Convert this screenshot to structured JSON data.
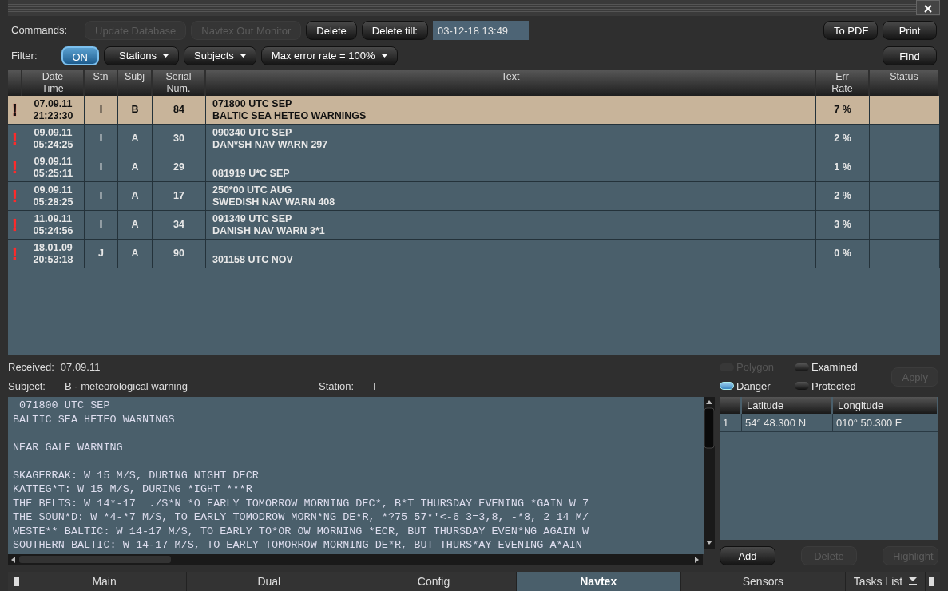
{
  "commands": {
    "label": "Commands:",
    "buttons": [
      {
        "label": "Update Database",
        "disabled": true
      },
      {
        "label": "Navtex Out Monitor",
        "disabled": true
      },
      {
        "label": "Delete",
        "disabled": false
      },
      {
        "label": "Delete till:",
        "disabled": false
      }
    ],
    "delete_till_value": "03-12-18 13:49",
    "right_buttons": [
      "To PDF",
      "Print"
    ]
  },
  "filter": {
    "label": "Filter:",
    "toggle": {
      "label": "ON",
      "on": true
    },
    "dropdowns": [
      "Stations",
      "Subjects",
      "Max error rate = 100%"
    ],
    "find_button": "Find"
  },
  "table": {
    "columns": [
      "Date Time",
      "Stn",
      "Subj",
      "Serial Num.",
      "Text",
      "Err Rate",
      "Status"
    ],
    "rows": [
      {
        "flag": "!",
        "date": "07.09.11",
        "time": "21:23:30",
        "stn": "I",
        "subj": "B",
        "serial": "84",
        "text": [
          "071800 UTC SEP",
          "BALTIC SEA HETEO WARNINGS"
        ],
        "err": "7 %",
        "selected": true
      },
      {
        "flag": "!",
        "date": "09.09.11",
        "time": "05:24:25",
        "stn": "I",
        "subj": "A",
        "serial": "30",
        "text": [
          "090340 UTC SEP",
          "DAN*SH NAV WARN 297"
        ],
        "err": "2 %",
        "selected": false
      },
      {
        "flag": "!",
        "date": "09.09.11",
        "time": "05:25:11",
        "stn": "I",
        "subj": "A",
        "serial": "29",
        "text": [
          "081919 U*C SEP"
        ],
        "err": "1 %",
        "selected": false
      },
      {
        "flag": "!",
        "date": "09.09.11",
        "time": "05:28:25",
        "stn": "I",
        "subj": "A",
        "serial": "17",
        "text": [
          "250*00 UTC AUG",
          "SWEDISH NAV WARN 408"
        ],
        "err": "2 %",
        "selected": false
      },
      {
        "flag": "!",
        "date": "11.09.11",
        "time": "05:24:56",
        "stn": "I",
        "subj": "A",
        "serial": "34",
        "text": [
          "091349 UTC SEP",
          "DANISH NAV WARN 3*1"
        ],
        "err": "3 %",
        "selected": false
      },
      {
        "flag": "!",
        "date": "18.01.09",
        "time": "20:53:18",
        "stn": "J",
        "subj": "A",
        "serial": "90",
        "text": [
          "301158 UTC NOV"
        ],
        "err": "0 %",
        "selected": false
      }
    ]
  },
  "details": {
    "received_label": "Received:",
    "received": "07.09.11",
    "subject_label": "Subject:",
    "subject": "B - meteorological warning",
    "station_label": "Station:",
    "station": "I",
    "message_paragraphs": [
      [
        " 071800 UTC SEP",
        "BALTIC SEA HETEO WARNINGS"
      ],
      [
        "NEAR GALE WARNING"
      ],
      [
        "SKAGERRAK: W 15 M/S, DURING NIGHT DECR",
        "KATTEG*T: W 15 M/S, DURING *IGHT ***R",
        "THE BELTS: W 14*-17  ./S*N *O EARLY TOMORROW MORNING DEC*, B*T THURSDAY EVENING *GAIN W 7",
        "THE SOUN*D: W *4-*7 M/S, TO EARLY TOMODROW MORN*NG DE*R, *?75 57*'<-6 3=3,8, -*8, 2 14 M/",
        "WESTE** BALTIC: W 14-17 M/S, TO EARLY TO*OR OW MORNING *ECR, BUT THURSDAY EVEN*NG AGAIN W",
        "SOUTHERN BALTIC: W 14-17 M/S, TO EARLY TOMORROW MORNING DE*R, BUT THURS*AY EVENING A*AIN"
      ]
    ]
  },
  "area": {
    "options": [
      {
        "label": "Polygon",
        "checked": false,
        "disabled": true
      },
      {
        "label": "Examined",
        "checked": false,
        "disabled": false
      },
      {
        "label": "Danger",
        "checked": true,
        "disabled": false
      },
      {
        "label": "Protected",
        "checked": false,
        "disabled": false
      }
    ],
    "apply_button": {
      "label": "Apply",
      "disabled": true
    },
    "columns": [
      "Latitude",
      "Longitude"
    ],
    "rows": [
      {
        "index": "1",
        "latitude": "54° 48.300 N",
        "longitude": "010° 50.300 E"
      }
    ],
    "buttons": [
      {
        "label": "Add",
        "disabled": false
      },
      {
        "label": "Delete",
        "disabled": true
      },
      {
        "label": "Highlight",
        "disabled": true
      }
    ]
  },
  "tabs": [
    {
      "label": "Main",
      "selected": false
    },
    {
      "label": "Dual",
      "selected": false
    },
    {
      "label": "Config",
      "selected": false
    },
    {
      "label": "Navtex",
      "selected": true
    },
    {
      "label": "Sensors",
      "selected": false
    }
  ],
  "tasks_list": "Tasks List"
}
